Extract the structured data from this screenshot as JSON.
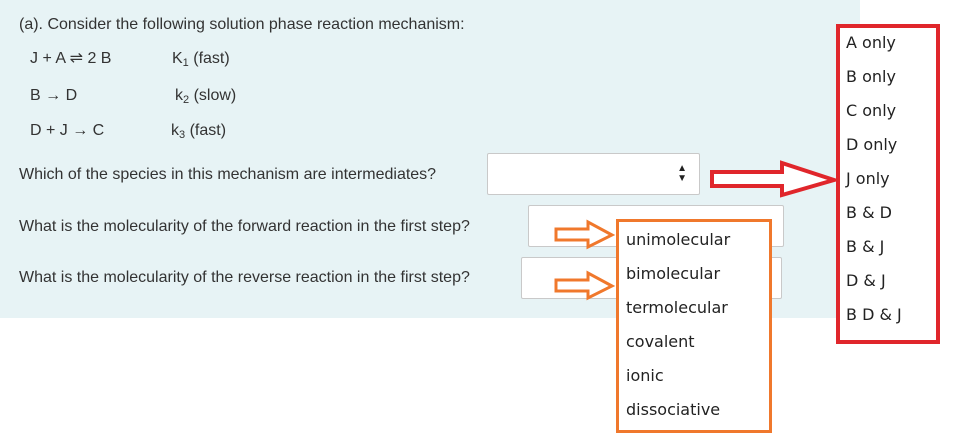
{
  "question": {
    "heading": "(a). Consider the following solution phase reaction mechanism:",
    "steps": [
      {
        "eq": "J + A ⇌ 2 B",
        "k": "K",
        "k_sub": "1",
        "speed": "(fast)"
      },
      {
        "eq": "B → D",
        "k": "k",
        "k_sub": "2",
        "speed": "(slow)"
      },
      {
        "eq": "D + J → C",
        "k": "k",
        "k_sub": "3",
        "speed": "(fast)"
      }
    ],
    "q1": "Which of the species in this mechanism are intermediates?",
    "q2": "What is the molecularity of the forward reaction in the first step?",
    "q3": "What is the molecularity of the reverse reaction in the first step?"
  },
  "species_options": [
    "A only",
    "B only",
    "C only",
    "D only",
    "J only",
    "B & D",
    "B & J",
    "D & J",
    "B D & J"
  ],
  "molecularity_options": [
    "unimolecular",
    "bimolecular",
    "termolecular",
    "covalent",
    "ionic",
    "dissociative"
  ],
  "icons": {
    "select_arrow": "updown-icon",
    "pointer": "arrow-right-icon"
  },
  "colors": {
    "panel": "#e7f3f5",
    "red_highlight": "#e0262b",
    "orange_highlight": "#f0782c"
  }
}
